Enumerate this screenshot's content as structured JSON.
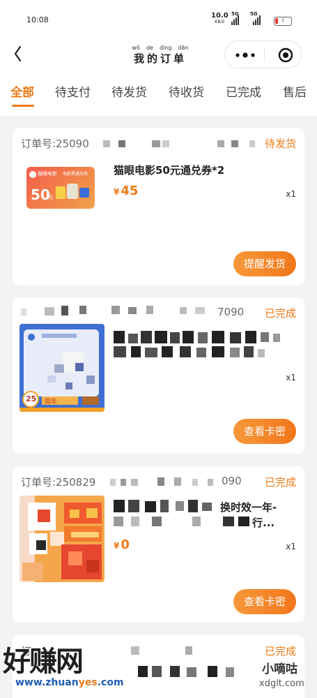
{
  "status_bar": {
    "time": "10:08",
    "network_speed": "10.0",
    "network_unit": "KB/S",
    "sim1": "5G",
    "sim2": "5G",
    "battery": "7"
  },
  "nav": {
    "title_pinyin": [
      "wǒ",
      "de",
      "dìng",
      "dān"
    ],
    "title": "我的订单",
    "icons": [
      "back-arrow-icon",
      "more-dots-icon",
      "target-icon"
    ]
  },
  "tabs": [
    {
      "label": "全部",
      "active": true
    },
    {
      "label": "待支付"
    },
    {
      "label": "待发货"
    },
    {
      "label": "待收货"
    },
    {
      "label": "已完成"
    },
    {
      "label": "售后"
    }
  ],
  "orders": [
    {
      "order_no": "订单号:25090",
      "status": "待发货",
      "product_name": "猫眼电影50元通兑券*2",
      "currency": "¥",
      "price": "45",
      "quantity": "x1",
      "action": "提醒发货",
      "thumb": {
        "brand": "猫眼电影",
        "value": "50",
        "unit": "元",
        "caption": "电影票通兑券"
      }
    },
    {
      "order_no": "",
      "order_no_tail": "7090",
      "status": "已完成",
      "product_name": "",
      "quantity": "x1",
      "action": "查看卡密",
      "thumb": {
        "badge": "25",
        "caption": "周年"
      }
    },
    {
      "order_no": "订单号:250829",
      "order_no_tail": "090",
      "status": "已完成",
      "product_name_line1": "换时效一年-",
      "product_name_line2": "行...",
      "currency": "¥",
      "price": "0",
      "quantity": "x1",
      "action": "查看卡密"
    },
    {
      "order_no": "订",
      "status": "已完成"
    }
  ],
  "watermarks": {
    "left_big": "好赚网",
    "left_url_a": "www.zhuan",
    "left_url_b": "yes",
    "left_url_c": ".com",
    "right_cn": "小嘀咕",
    "right_en": "xdglt.com"
  },
  "colors": {
    "accent": "#ef7a16",
    "background": "#f3f3f3"
  }
}
